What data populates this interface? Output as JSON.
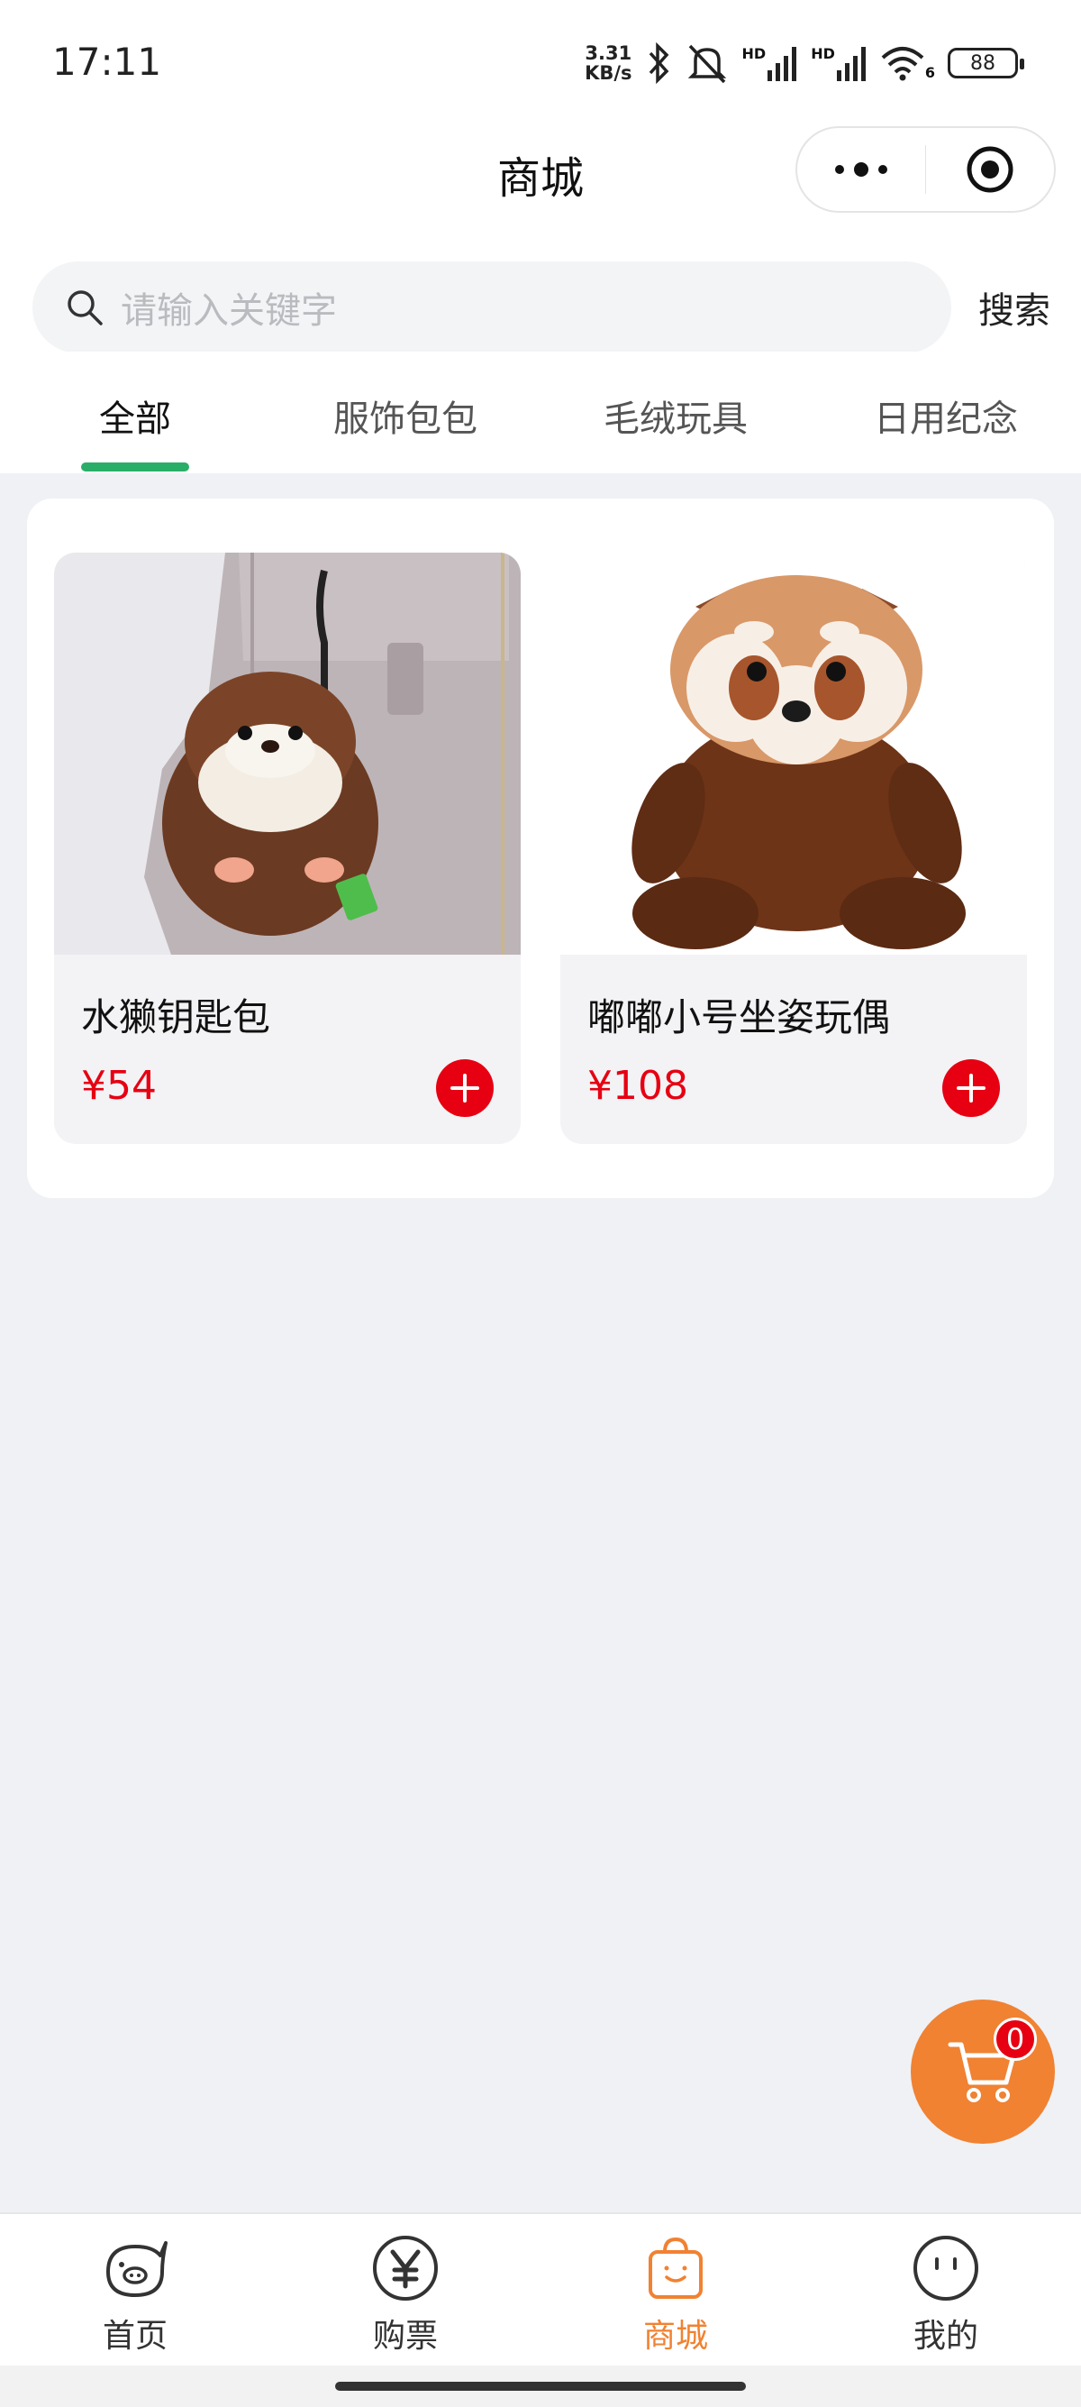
{
  "status_bar": {
    "time": "17:11",
    "net_speed_value": "3.31",
    "net_speed_unit": "KB/s",
    "signal_1_label": "HD",
    "signal_2_label": "HD",
    "wifi_label": "6",
    "battery": "88"
  },
  "header": {
    "title": "商城",
    "more_icon": "more-dots-icon",
    "close_icon": "target-circle-icon"
  },
  "search": {
    "placeholder": "请输入关键字",
    "button_label": "搜索"
  },
  "tabs": [
    {
      "label": "全部",
      "active": true
    },
    {
      "label": "服饰包包",
      "active": false
    },
    {
      "label": "毛绒玩具",
      "active": false
    },
    {
      "label": "日用纪念",
      "active": false
    }
  ],
  "products": [
    {
      "name": "水獭钥匙包",
      "price": "¥54",
      "image": "otter-keychain-plush"
    },
    {
      "name": "嘟嘟小号坐姿玩偶",
      "price": "¥108",
      "image": "red-panda-plush"
    }
  ],
  "cart": {
    "count": "0",
    "icon": "cart-icon"
  },
  "bottom_nav": [
    {
      "label": "首页",
      "icon": "pig-face-icon",
      "active": false
    },
    {
      "label": "购票",
      "icon": "yen-circle-icon",
      "active": false
    },
    {
      "label": "商城",
      "icon": "shopping-bag-icon",
      "active": true
    },
    {
      "label": "我的",
      "icon": "smile-face-icon",
      "active": false
    }
  ],
  "colors": {
    "accent_green": "#2aae67",
    "price_red": "#e60012",
    "cart_orange": "#f08232",
    "page_bg": "#eff1f5"
  }
}
